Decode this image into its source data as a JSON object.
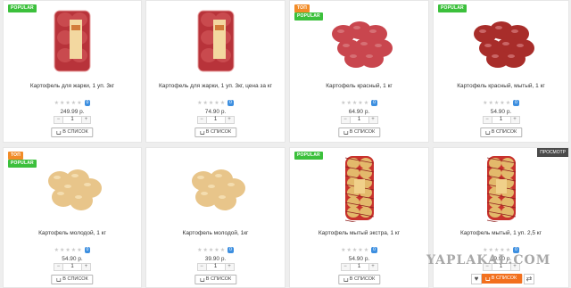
{
  "products": [
    {
      "name": "Картофель для жарки, 1 уп. 3кг",
      "price": "249.99 р.",
      "qty": "1",
      "cart_label": "В СПИСОК",
      "rating_count": "0",
      "badges": [
        "POPULAR"
      ],
      "image": "red-bag"
    },
    {
      "name": "Картофель для жарки, 1 уп. 3кг, цена за кг",
      "price": "74.90 р.",
      "qty": "1",
      "cart_label": "В СПИСОК",
      "rating_count": "0",
      "badges": [],
      "image": "red-bag"
    },
    {
      "name": "Картофель красный, 1 кг",
      "price": "64.90 р.",
      "qty": "1",
      "cart_label": "В СПИСОК",
      "rating_count": "0",
      "badges": [
        "ТОП",
        "POPULAR"
      ],
      "image": "red-pile"
    },
    {
      "name": "Картофель красный, мытый, 1 кг",
      "price": "54.90 р.",
      "qty": "1",
      "cart_label": "В СПИСОК",
      "rating_count": "0",
      "badges": [
        "POPULAR"
      ],
      "image": "red-pile-dark"
    },
    {
      "name": "Картофель молодой, 1 кг",
      "price": "54.90 р.",
      "qty": "1",
      "cart_label": "В СПИСОК",
      "rating_count": "0",
      "badges": [
        "ТОП",
        "POPULAR"
      ],
      "image": "yellow-pile"
    },
    {
      "name": "Картофель молодой, 1кг",
      "price": "39.90 р.",
      "qty": "1",
      "cart_label": "В СПИСОК",
      "rating_count": "0",
      "badges": [],
      "image": "yellow-pile"
    },
    {
      "name": "Картофель мытый экстра, 1 кг",
      "price": "54.90 р.",
      "qty": "1",
      "cart_label": "В СПИСОК",
      "rating_count": "0",
      "badges": [
        "POPULAR"
      ],
      "image": "net-bag"
    },
    {
      "name": "Картофель мытый, 1 уп. 2,5 кг",
      "price": "99.90 р.",
      "qty": "1",
      "cart_label": "В СПИСОК",
      "rating_count": "0",
      "badges": [],
      "image": "net-bag"
    }
  ],
  "view_label": "ПРОСМОТР",
  "watermark": "YAPLAKAL.COM",
  "colors": {
    "top_badge": "#f28c28",
    "popular_badge": "#3cc03c",
    "cart_active": "#f2701e",
    "rating_count": "#3d8fe0"
  },
  "icons": {
    "heart": "♥",
    "compare": "⇄"
  }
}
